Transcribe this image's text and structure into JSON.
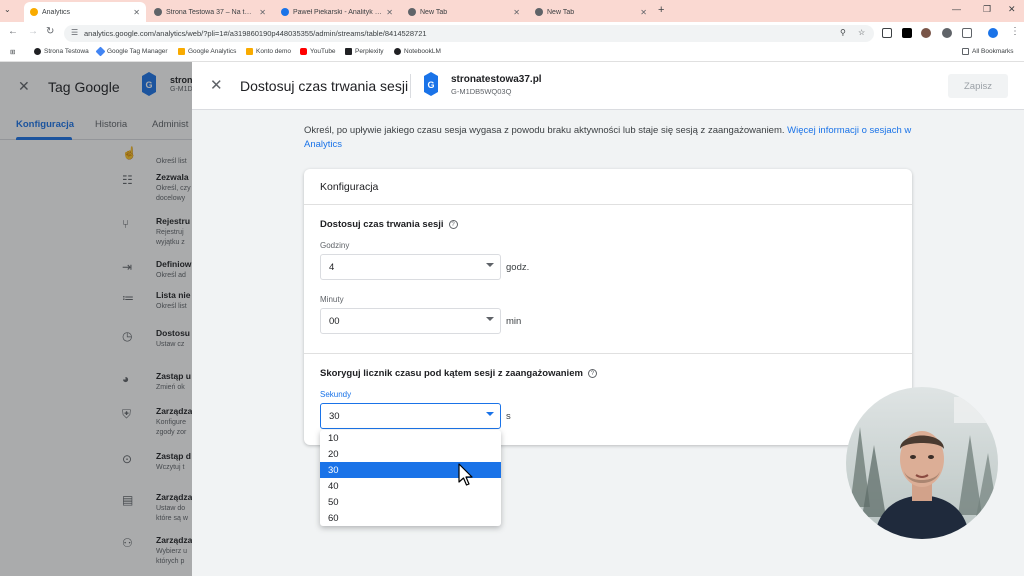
{
  "browser": {
    "tabs": [
      {
        "title": "Analytics",
        "active": true,
        "icon_color": "#f9ab00"
      },
      {
        "title": "Strona Testowa 37 – Na tej stronie…",
        "active": false,
        "icon_color": "#5f6368"
      },
      {
        "title": "Paweł Piekarski - Analityk Interne…",
        "active": false,
        "icon_color": "#1a73e8"
      },
      {
        "title": "New Tab",
        "active": false,
        "icon_color": "#5f6368"
      },
      {
        "title": "New Tab",
        "active": false,
        "icon_color": "#5f6368"
      }
    ],
    "url": "analytics.google.com/analytics/web/?pli=1#/a319860190p448035355/admin/streams/table/8414528721",
    "bookmarks": [
      {
        "label": "Strona Testowa",
        "icon_color": "#202124"
      },
      {
        "label": "Google Tag Manager",
        "icon_color": "#4285f4"
      },
      {
        "label": "Google Analytics",
        "icon_color": "#f9ab00"
      },
      {
        "label": "Konto demo",
        "icon_color": "#f9ab00"
      },
      {
        "label": "YouTube",
        "icon_color": "#ff0000"
      },
      {
        "label": "Perplexity",
        "icon_color": "#202124"
      },
      {
        "label": "NotebookLM",
        "icon_color": "#202124"
      }
    ],
    "all_bookmarks": "All Bookmarks"
  },
  "underlying": {
    "title": "Tag Google",
    "stream_name": "stron",
    "stream_id": "G-M1D",
    "tabs": [
      "Konfiguracja",
      "Historia",
      "Administ"
    ],
    "items": [
      {
        "icon": "cursor-icon",
        "glyph": "☝",
        "title": "",
        "desc": [
          "Określ list"
        ]
      },
      {
        "icon": "settings-list-icon",
        "glyph": "☷",
        "title": "Zezwala",
        "desc": [
          "Określ, czy",
          "docelowy"
        ]
      },
      {
        "icon": "split-icon",
        "glyph": "⑂",
        "title": "Rejestru",
        "desc": [
          "Rejestruj",
          "wyjątku z"
        ]
      },
      {
        "icon": "login-icon",
        "glyph": "⇥",
        "title": "Definiow",
        "desc": [
          "Określ ad"
        ]
      },
      {
        "icon": "checklist-icon",
        "glyph": "≔",
        "title": "Lista nie",
        "desc": [
          "Określ list"
        ]
      },
      {
        "icon": "clock-icon",
        "glyph": "◷",
        "title": "Dostosu",
        "desc": [
          "Ustaw cz"
        ]
      },
      {
        "icon": "cookie-icon",
        "glyph": "◕",
        "title": "Zastąp u",
        "desc": [
          "Zmień ok"
        ]
      },
      {
        "icon": "shield-icon",
        "glyph": "⛨",
        "title": "Zarządza",
        "desc": [
          "Konfigure",
          "zgody zor"
        ]
      },
      {
        "icon": "ip-icon",
        "glyph": "⊙",
        "title": "Zastąp d",
        "desc": [
          "Wczytuj t"
        ]
      },
      {
        "icon": "form-icon",
        "glyph": "▤",
        "title": "Zarządza",
        "desc": [
          "Ustaw do",
          "które są w"
        ]
      },
      {
        "icon": "network-icon",
        "glyph": "⚇",
        "title": "Zarządza",
        "desc": [
          "Wybierz u",
          "których p"
        ]
      }
    ]
  },
  "panel": {
    "title": "Dostosuj czas trwania sesji",
    "stream_name": "stronatestowa37.pl",
    "stream_id": "G-M1DB5WQ03Q",
    "save_label": "Zapisz",
    "description": "Określ, po upływie jakiego czasu sesja wygasa z powodu braku aktywności lub staje się sesją z zaangażowaniem.",
    "learn_more": "Więcej informacji o sesjach w Analytics",
    "card_title": "Konfiguracja",
    "session_section": {
      "title": "Dostosuj czas trwania sesji",
      "hours_label": "Godziny",
      "hours_value": "4",
      "hours_unit": "godz.",
      "minutes_label": "Minuty",
      "minutes_value": "00",
      "minutes_unit": "min"
    },
    "engaged_section": {
      "title": "Skoryguj licznik czasu pod kątem sesji z zaangażowaniem",
      "seconds_label": "Sekundy",
      "seconds_value": "30",
      "seconds_unit": "s",
      "options": [
        "10",
        "20",
        "30",
        "40",
        "50",
        "60"
      ],
      "selected_option": "30"
    }
  }
}
